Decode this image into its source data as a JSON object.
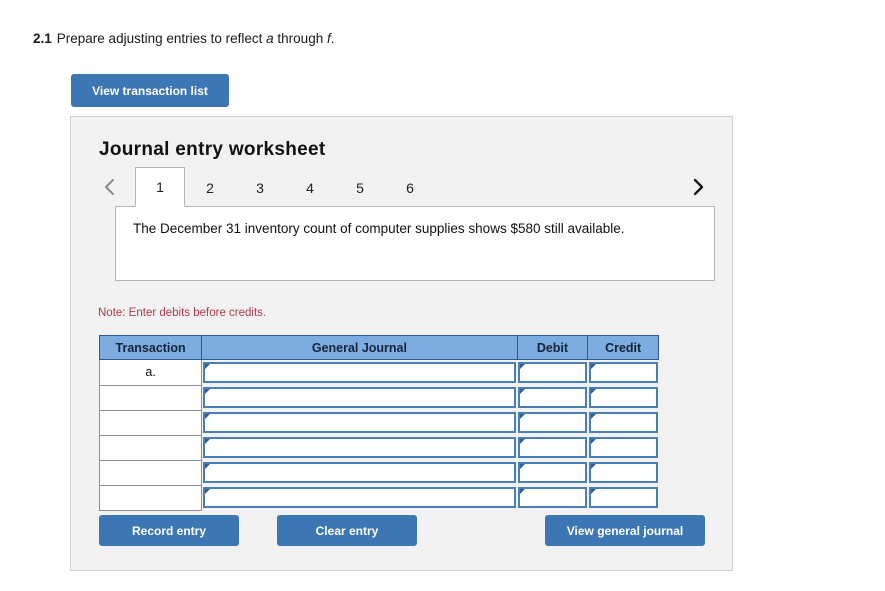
{
  "question": {
    "number": "2.1",
    "text_before": "Prepare adjusting entries to reflect ",
    "italic_a": "a",
    "text_middle": " through ",
    "italic_f": "f",
    "text_after": "."
  },
  "toolbar": {
    "view_transaction_list_label": "View transaction list"
  },
  "panel": {
    "title": "Journal entry worksheet",
    "prev_icon": "chevron-left-icon",
    "next_icon": "chevron-right-icon",
    "tabs": [
      {
        "label": "1",
        "active": true
      },
      {
        "label": "2",
        "active": false
      },
      {
        "label": "3",
        "active": false
      },
      {
        "label": "4",
        "active": false
      },
      {
        "label": "5",
        "active": false
      },
      {
        "label": "6",
        "active": false
      }
    ],
    "prompt": "The December 31 inventory count of computer supplies shows $580 still available.",
    "note": "Note: Enter debits before credits.",
    "table": {
      "headers": [
        "Transaction",
        "General Journal",
        "Debit",
        "Credit"
      ],
      "rows": [
        {
          "transaction": "a.",
          "general_journal": "",
          "debit": "",
          "credit": ""
        },
        {
          "transaction": "",
          "general_journal": "",
          "debit": "",
          "credit": ""
        },
        {
          "transaction": "",
          "general_journal": "",
          "debit": "",
          "credit": ""
        },
        {
          "transaction": "",
          "general_journal": "",
          "debit": "",
          "credit": ""
        },
        {
          "transaction": "",
          "general_journal": "",
          "debit": "",
          "credit": ""
        },
        {
          "transaction": "",
          "general_journal": "",
          "debit": "",
          "credit": ""
        }
      ]
    },
    "actions": {
      "record_entry_label": "Record entry",
      "clear_entry_label": "Clear entry",
      "view_general_journal_label": "View general journal"
    }
  },
  "colors": {
    "button_blue": "#3d77b3",
    "table_header_blue": "#7dace0",
    "note_red": "#b03a4b",
    "panel_bg": "#f2f2f2",
    "input_border_blue": "#4a7fb5"
  }
}
